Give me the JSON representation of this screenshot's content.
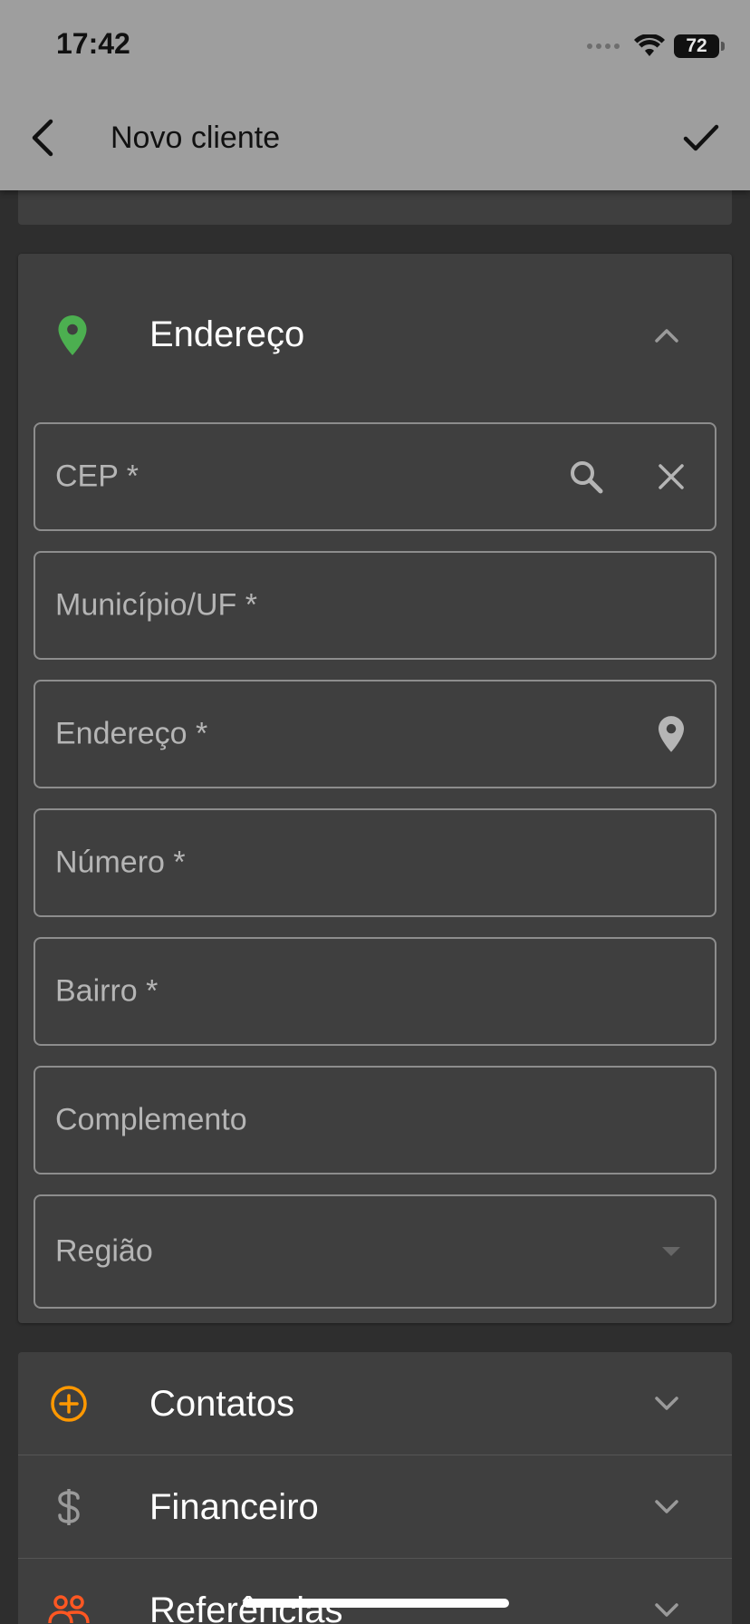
{
  "status_bar": {
    "time": "17:42",
    "battery": "72"
  },
  "app_bar": {
    "title": "Novo cliente"
  },
  "address_section": {
    "title": "Endereço",
    "fields": {
      "cep": "CEP *",
      "municipio": "Município/UF *",
      "endereco": "Endereço *",
      "numero": "Número *",
      "bairro": "Bairro *",
      "complemento": "Complemento",
      "regiao": "Região"
    }
  },
  "sections": {
    "contatos": "Contatos",
    "financeiro": "Financeiro",
    "referencias": "Referências"
  },
  "colors": {
    "location_green": "#4caf50",
    "contacts_orange": "#ff9800",
    "references_orange": "#ff5722",
    "field_border": "#8d8d8d"
  },
  "icons": [
    "back-arrow-icon",
    "check-icon",
    "location-pin-icon",
    "chevron-up-icon",
    "search-icon",
    "close-icon",
    "dropdown-arrow-icon",
    "add-circle-icon",
    "dollar-icon",
    "people-icon",
    "chevron-down-icon"
  ]
}
